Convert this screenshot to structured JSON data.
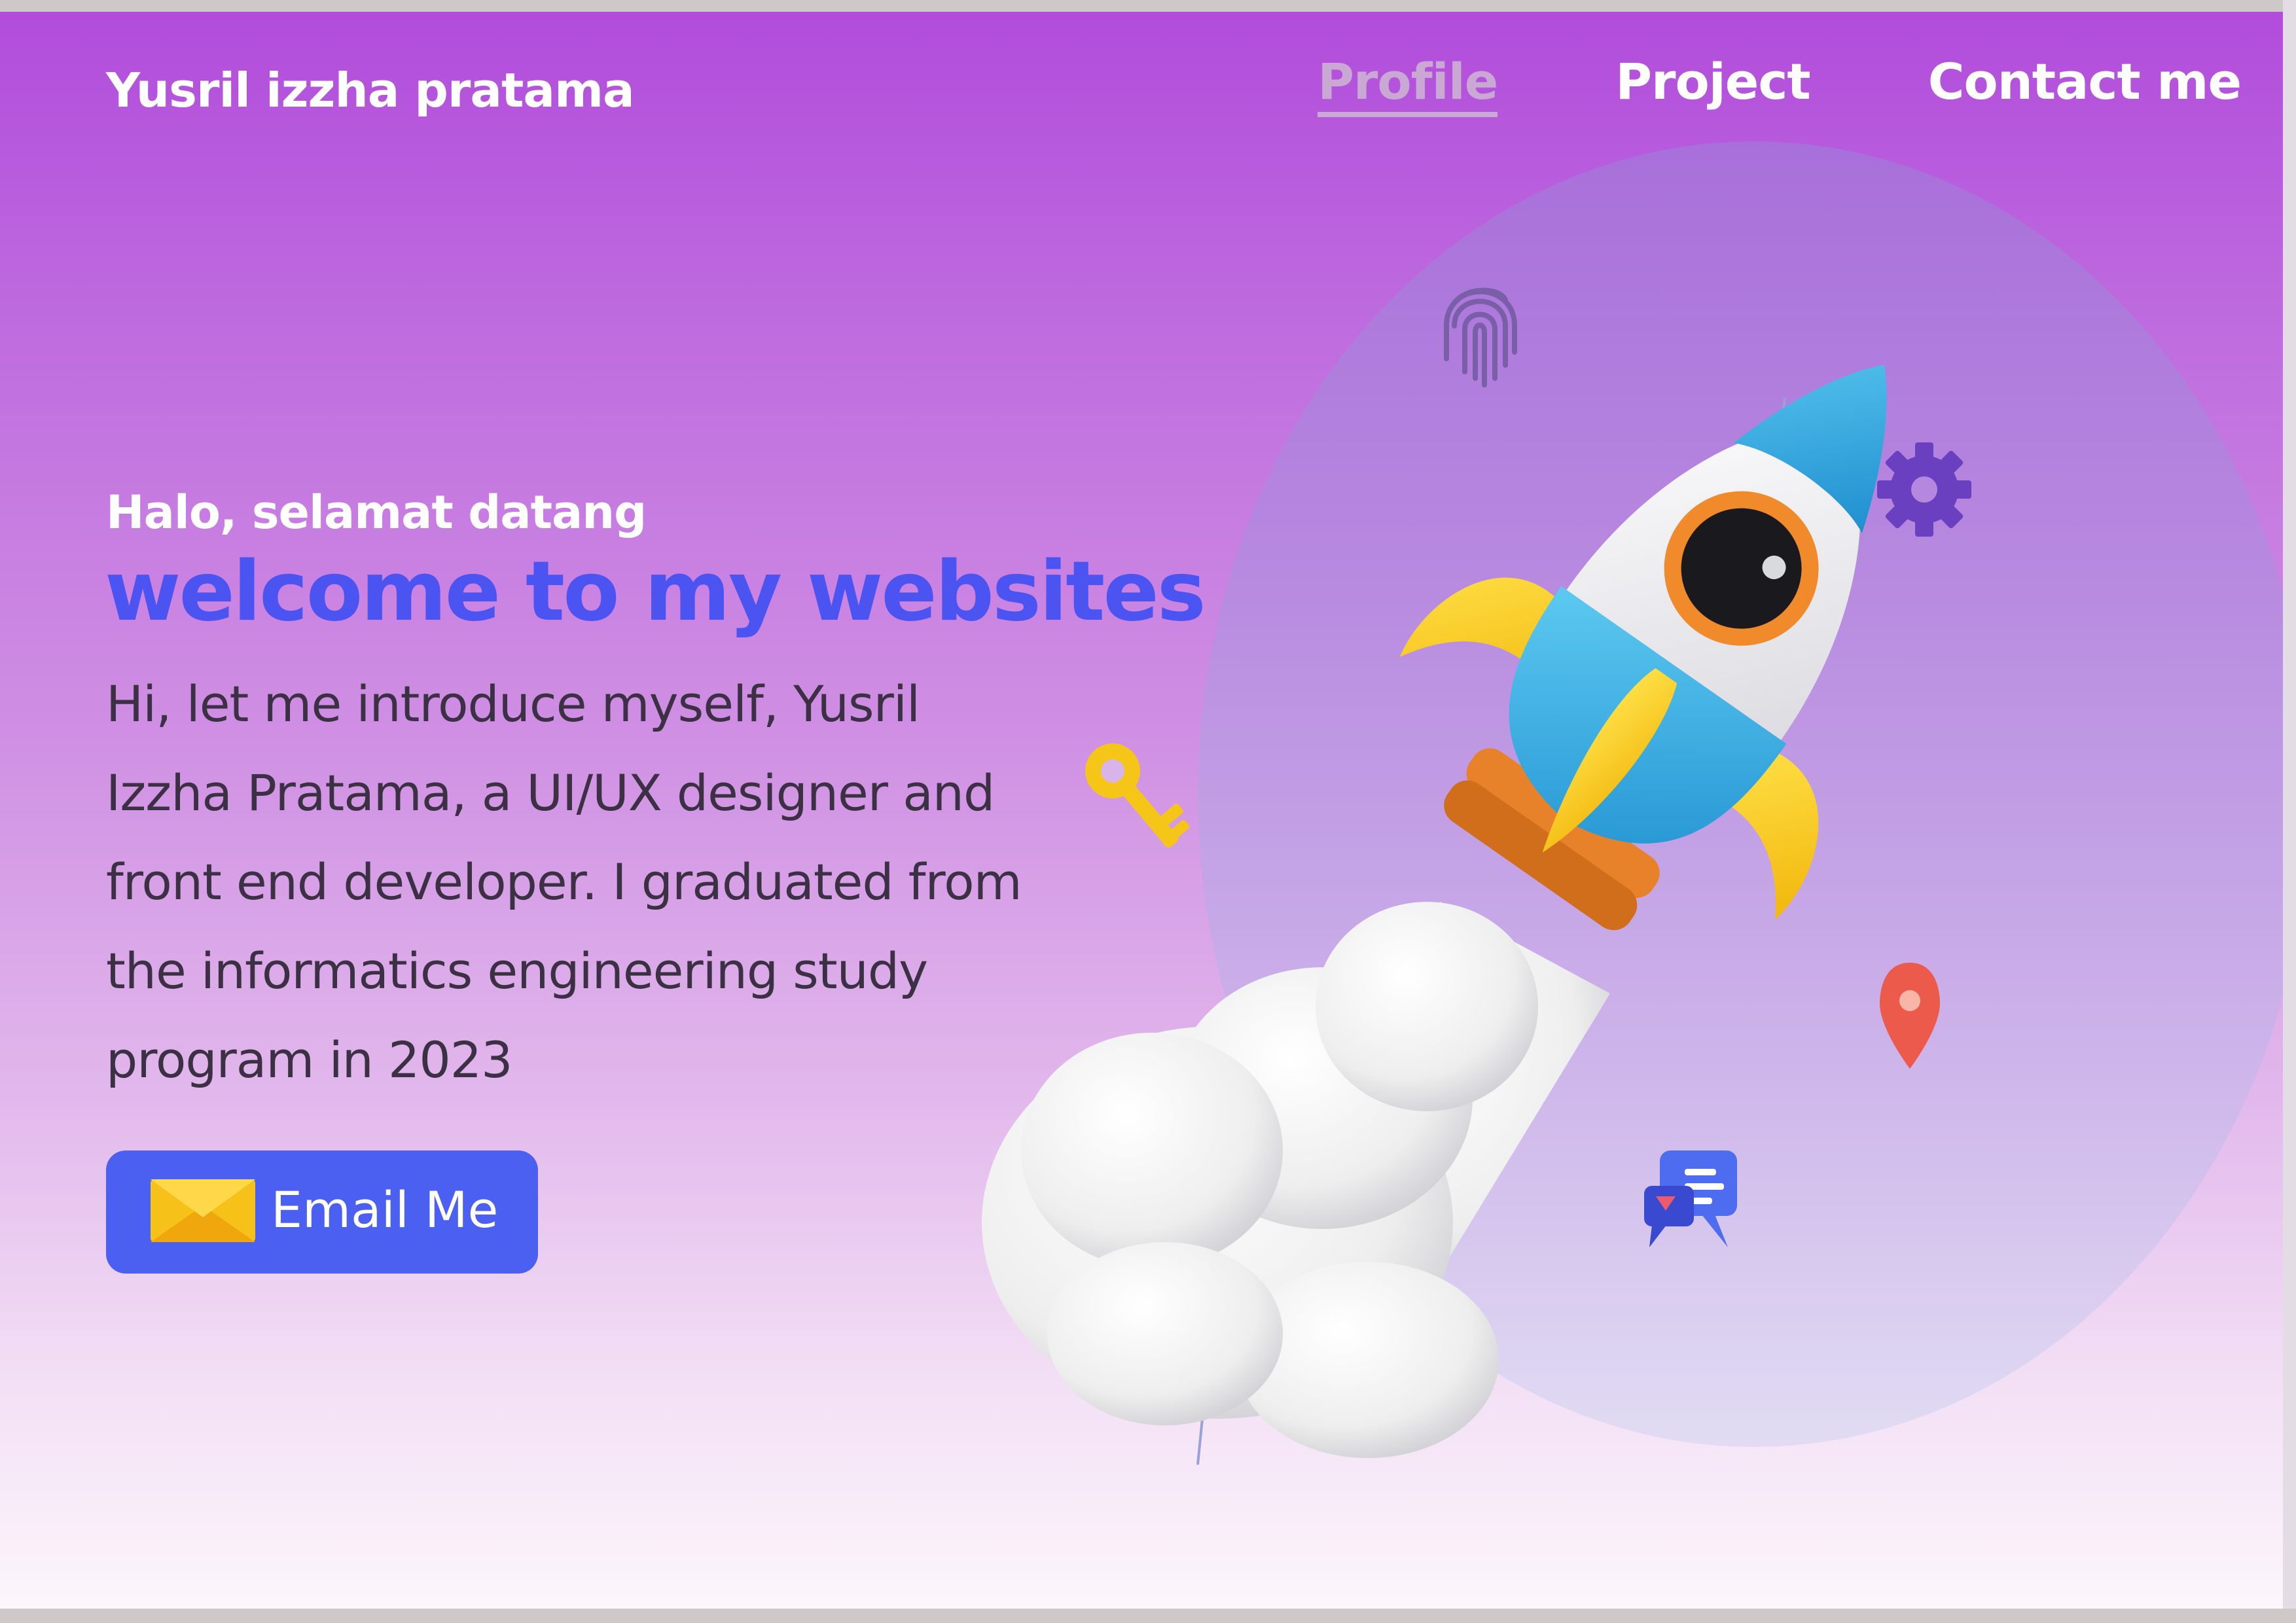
{
  "header": {
    "brand": "Yusril izzha pratama",
    "nav": [
      {
        "label": "Profile",
        "active": true
      },
      {
        "label": "Project",
        "active": false
      },
      {
        "label": "Contact me",
        "active": false
      }
    ]
  },
  "hero": {
    "greeting": "Halo, selamat datang",
    "headline": "welcome to my websites",
    "intro_lines": [
      "Hi, let me introduce myself, Yusril",
      "Izzha Pratama, a UI/UX designer and",
      "front end developer. I graduated from",
      "the informatics engineering study",
      "program in 2023"
    ],
    "cta_label": "Email Me"
  },
  "illustration": {
    "icons": [
      "rocket-icon",
      "cloud-icon",
      "fingerprint-icon",
      "gear-icon",
      "key-icon",
      "location-pin-icon",
      "chat-bubbles-icon",
      "envelope-icon"
    ]
  },
  "colors": {
    "gradient_top": "#b14cdb",
    "gradient_bottom": "#fcf6fc",
    "headline": "#4b54f0",
    "button": "#4b5ff0",
    "nav_active": "#c9a9d4"
  }
}
